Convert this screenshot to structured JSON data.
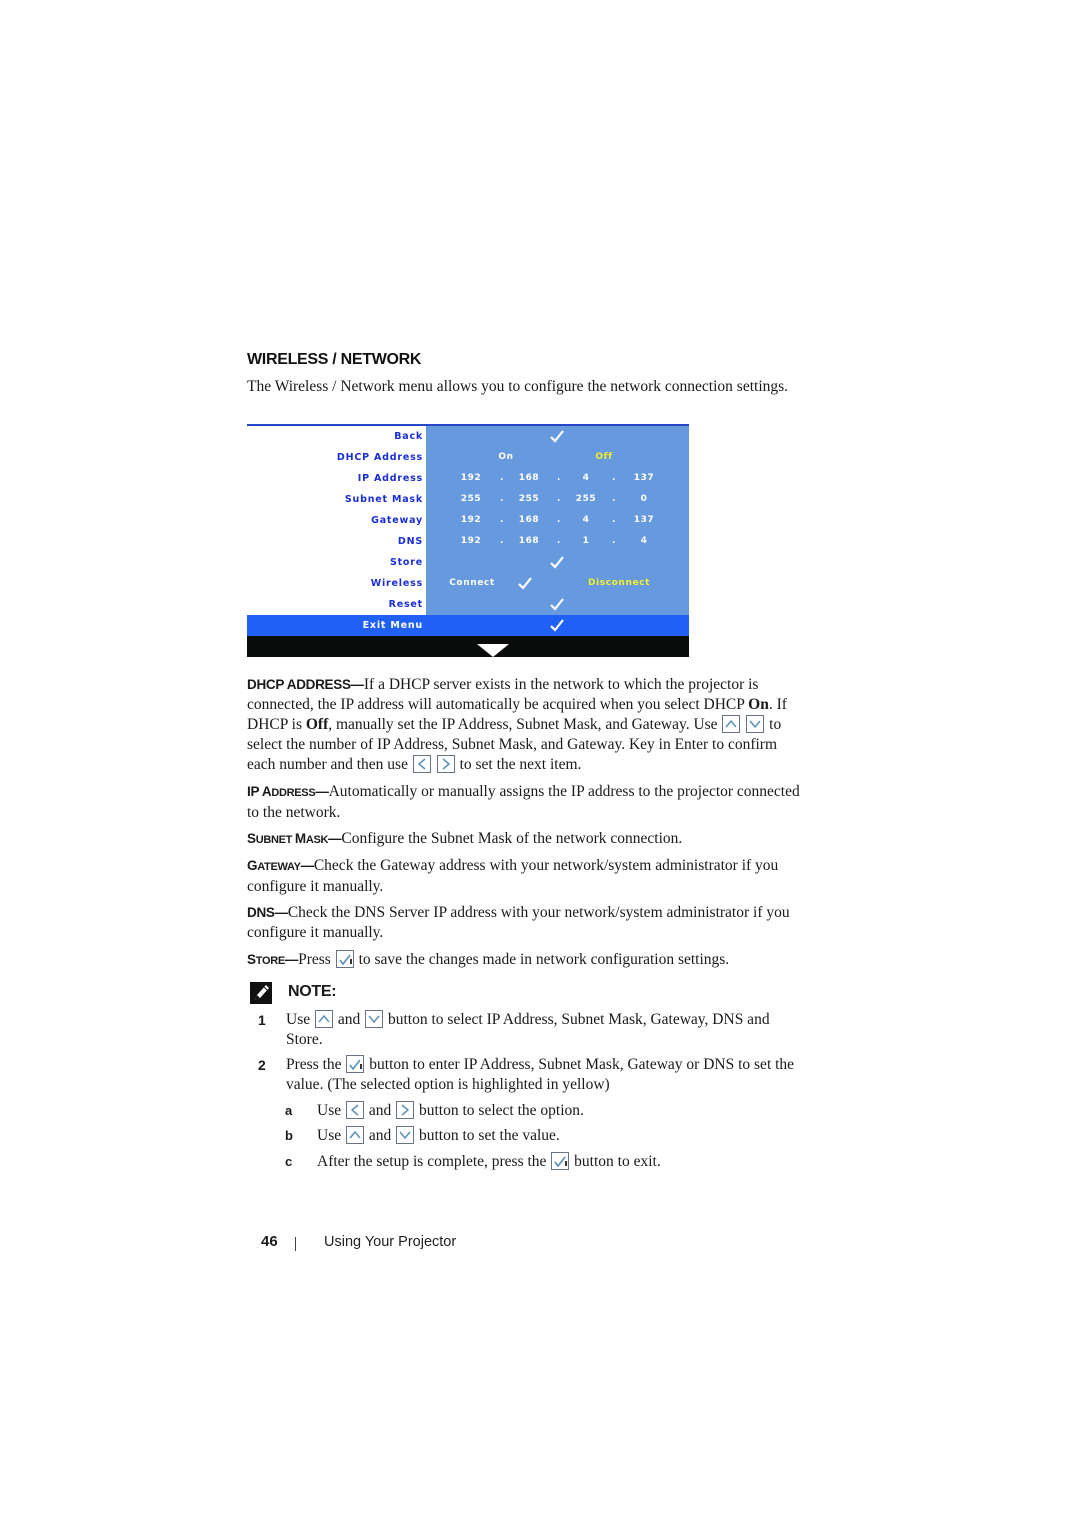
{
  "section": {
    "title": "WIRELESS / NETWORK",
    "intro": "The Wireless / Network menu allows you to configure the network connection settings."
  },
  "osd_menu": {
    "colors": {
      "label_text": "#1a2ed6",
      "value_panel": "#6699dd",
      "highlight_row": "#2060f4",
      "selected_option": "#f4f02a",
      "bottom_bar": "#0a0c0c"
    },
    "rows": {
      "back": {
        "label": "Back",
        "value_icon": "check-icon"
      },
      "dhcp": {
        "label": "DHCP Address",
        "option_on": "On",
        "option_off": "Off",
        "selected": "Off"
      },
      "ip": {
        "label": "IP Address",
        "octets": [
          "192",
          "168",
          "4",
          "137"
        ],
        "sep": "."
      },
      "subnet": {
        "label": "Subnet Mask",
        "octets": [
          "255",
          "255",
          "255",
          "0"
        ],
        "sep": "."
      },
      "gateway": {
        "label": "Gateway",
        "octets": [
          "192",
          "168",
          "4",
          "137"
        ],
        "sep": "."
      },
      "dns": {
        "label": "DNS",
        "octets": [
          "192",
          "168",
          "1",
          "4"
        ],
        "sep": "."
      },
      "store": {
        "label": "Store",
        "value_icon": "check-icon"
      },
      "wireless": {
        "label": "Wireless",
        "option_connect": "Connect",
        "option_disconnect": "Disconnect",
        "selected": "Disconnect"
      },
      "reset": {
        "label": "Reset",
        "value_icon": "check-icon"
      },
      "exit": {
        "label": "Exit Menu",
        "value_icon": "check-icon",
        "highlighted": true
      }
    },
    "scroll_indicator_icon": "down-triangle-icon"
  },
  "descriptions": {
    "dhcp": {
      "lead": "DHCP ADDRESS—",
      "text1": "If a DHCP server exists in the network to which the projector is connected, the IP address will automatically be acquired when you select DHCP ",
      "on": "On",
      "text2": ". If DHCP is ",
      "off": "Off",
      "text3": ", manually set the IP Address, Subnet Mask, and Gateway. Use ",
      "text4": " to select the number of IP Address, Subnet Mask, and Gateway. Key in Enter to confirm each number and then use ",
      "text5": " to set the next item."
    },
    "ip": {
      "lead_a": "IP A",
      "lead_b": "DDRESS",
      "lead_c": "—",
      "text": "Automatically or manually assigns the IP address to the projector connected to the network."
    },
    "subnet": {
      "lead_a": "S",
      "lead_b": "UBNET ",
      "lead_c": "M",
      "lead_d": "ASK",
      "lead_e": "—",
      "text": "Configure the Subnet Mask of the network connection."
    },
    "gateway": {
      "lead_a": "G",
      "lead_b": "ATEWAY",
      "lead_c": "—",
      "text": "Check the Gateway address with your network/system administrator if you configure it manually."
    },
    "dns": {
      "lead": "DNS—",
      "text": "Check the DNS Server IP address with your network/system administrator if you configure it manually."
    },
    "store": {
      "lead_a": "S",
      "lead_b": "TORE",
      "lead_c": "—",
      "text1": "Press ",
      "text2": " to save the changes made in network configuration settings."
    }
  },
  "note": {
    "label": "NOTE:",
    "items": [
      {
        "num": "1",
        "t1": "Use ",
        "t2": " and ",
        "t3": " button to select IP Address, Subnet Mask, Gateway, DNS and Store."
      },
      {
        "num": "2",
        "t1": "Press the ",
        "t2": " button to enter IP Address, Subnet Mask, Gateway or DNS to set the value. (The selected option is highlighted in yellow)"
      }
    ],
    "sub_items": [
      {
        "letter": "a",
        "t1": "Use ",
        "t2": " and ",
        "t3": " button to select the option."
      },
      {
        "letter": "b",
        "t1": "Use ",
        "t2": " and ",
        "t3": " button to set the value."
      },
      {
        "letter": "c",
        "t1": "After the setup is complete, press the ",
        "t2": " button to exit."
      }
    ]
  },
  "footer": {
    "page_number": "46",
    "chapter_title": "Using Your Projector"
  }
}
